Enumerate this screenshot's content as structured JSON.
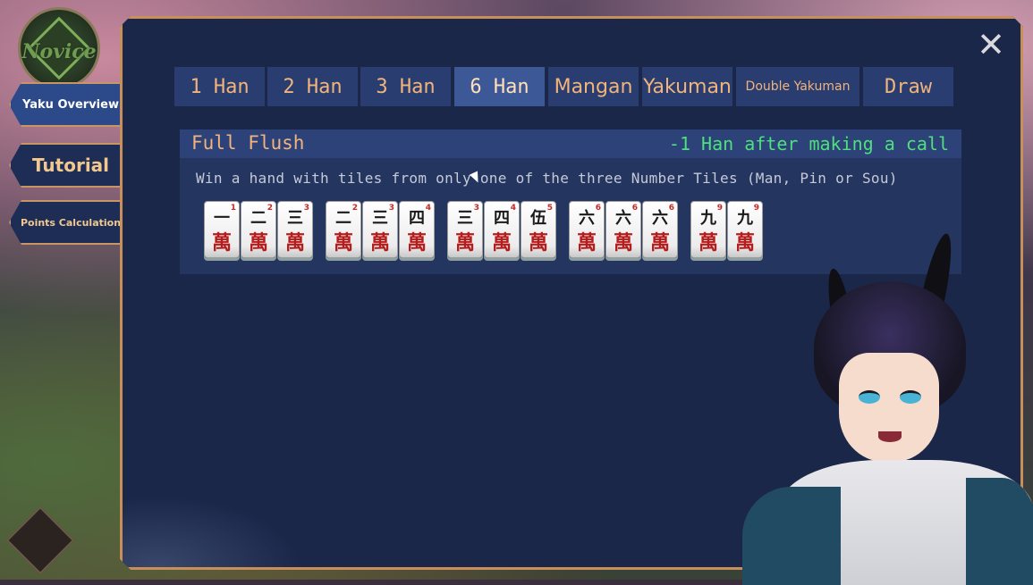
{
  "rank": {
    "label": "Novice"
  },
  "sidebar": {
    "items": [
      {
        "label": "Yaku Overview"
      },
      {
        "label": "Tutorial"
      },
      {
        "label": "Points Calculation"
      }
    ]
  },
  "close_icon": "✕",
  "tabs": [
    {
      "label": "1 Han"
    },
    {
      "label": "2 Han"
    },
    {
      "label": "3 Han"
    },
    {
      "label": "6 Han"
    },
    {
      "label": "Mangan"
    },
    {
      "label": "Yakuman"
    },
    {
      "label": "Double Yakuman"
    },
    {
      "label": "Draw"
    }
  ],
  "active_tab": "6 Han",
  "yaku": {
    "name": "Full Flush",
    "note": "-1 Han after making a call",
    "description": "Win a hand with tiles from only one of the three Number Tiles (Man, Pin or Sou)"
  },
  "tiles": [
    {
      "num": "一",
      "suit": "萬",
      "idx": "1"
    },
    {
      "num": "二",
      "suit": "萬",
      "idx": "2"
    },
    {
      "num": "三",
      "suit": "萬",
      "idx": "3"
    },
    {
      "num": "二",
      "suit": "萬",
      "idx": "2"
    },
    {
      "num": "三",
      "suit": "萬",
      "idx": "3"
    },
    {
      "num": "四",
      "suit": "萬",
      "idx": "4"
    },
    {
      "num": "三",
      "suit": "萬",
      "idx": "3"
    },
    {
      "num": "四",
      "suit": "萬",
      "idx": "4"
    },
    {
      "num": "伍",
      "suit": "萬",
      "idx": "5"
    },
    {
      "num": "六",
      "suit": "萬",
      "idx": "6"
    },
    {
      "num": "六",
      "suit": "萬",
      "idx": "6"
    },
    {
      "num": "六",
      "suit": "萬",
      "idx": "6"
    },
    {
      "num": "九",
      "suit": "萬",
      "idx": "9"
    },
    {
      "num": "九",
      "suit": "萬",
      "idx": "9"
    }
  ],
  "colors": {
    "panel": "#1b2749",
    "border": "#c98f58",
    "tab_text": "#f0b47c",
    "note_green": "#4ee07c",
    "man_red": "#b71c1c"
  }
}
